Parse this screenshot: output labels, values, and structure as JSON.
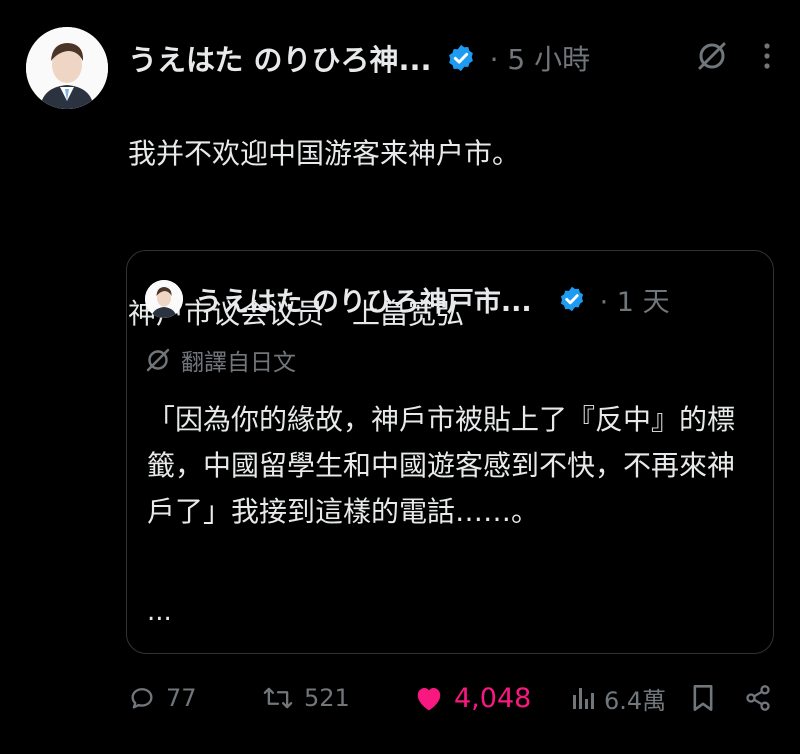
{
  "post": {
    "author_name": "うえはた のりひろ神...",
    "time": "· 5 小時",
    "text_line1": "我并不欢迎中国游客来神户市。",
    "text_line2": "神户市议会议员　上畠宽弘",
    "verified_color": "#1d9bf0"
  },
  "quote": {
    "author_name": "うえはた のりひろ神戸市...",
    "time": "· 1 天",
    "translate_label": "翻譯自日文",
    "text": "「因為你的緣故，神戶市被貼上了『反中』的標籤，中國留學生和中國遊客感到不快，不再來神戶了」我接到這樣的電話……。",
    "more": "..."
  },
  "actions": {
    "replies": "77",
    "reposts": "521",
    "likes": "4,048",
    "views": "6.4萬",
    "like_color": "#f91880"
  },
  "icons": [
    "grok-icon",
    "more-icon",
    "verified-icon",
    "translate-icon",
    "reply-icon",
    "repost-icon",
    "heart-icon",
    "views-icon",
    "bookmark-icon",
    "share-icon"
  ]
}
